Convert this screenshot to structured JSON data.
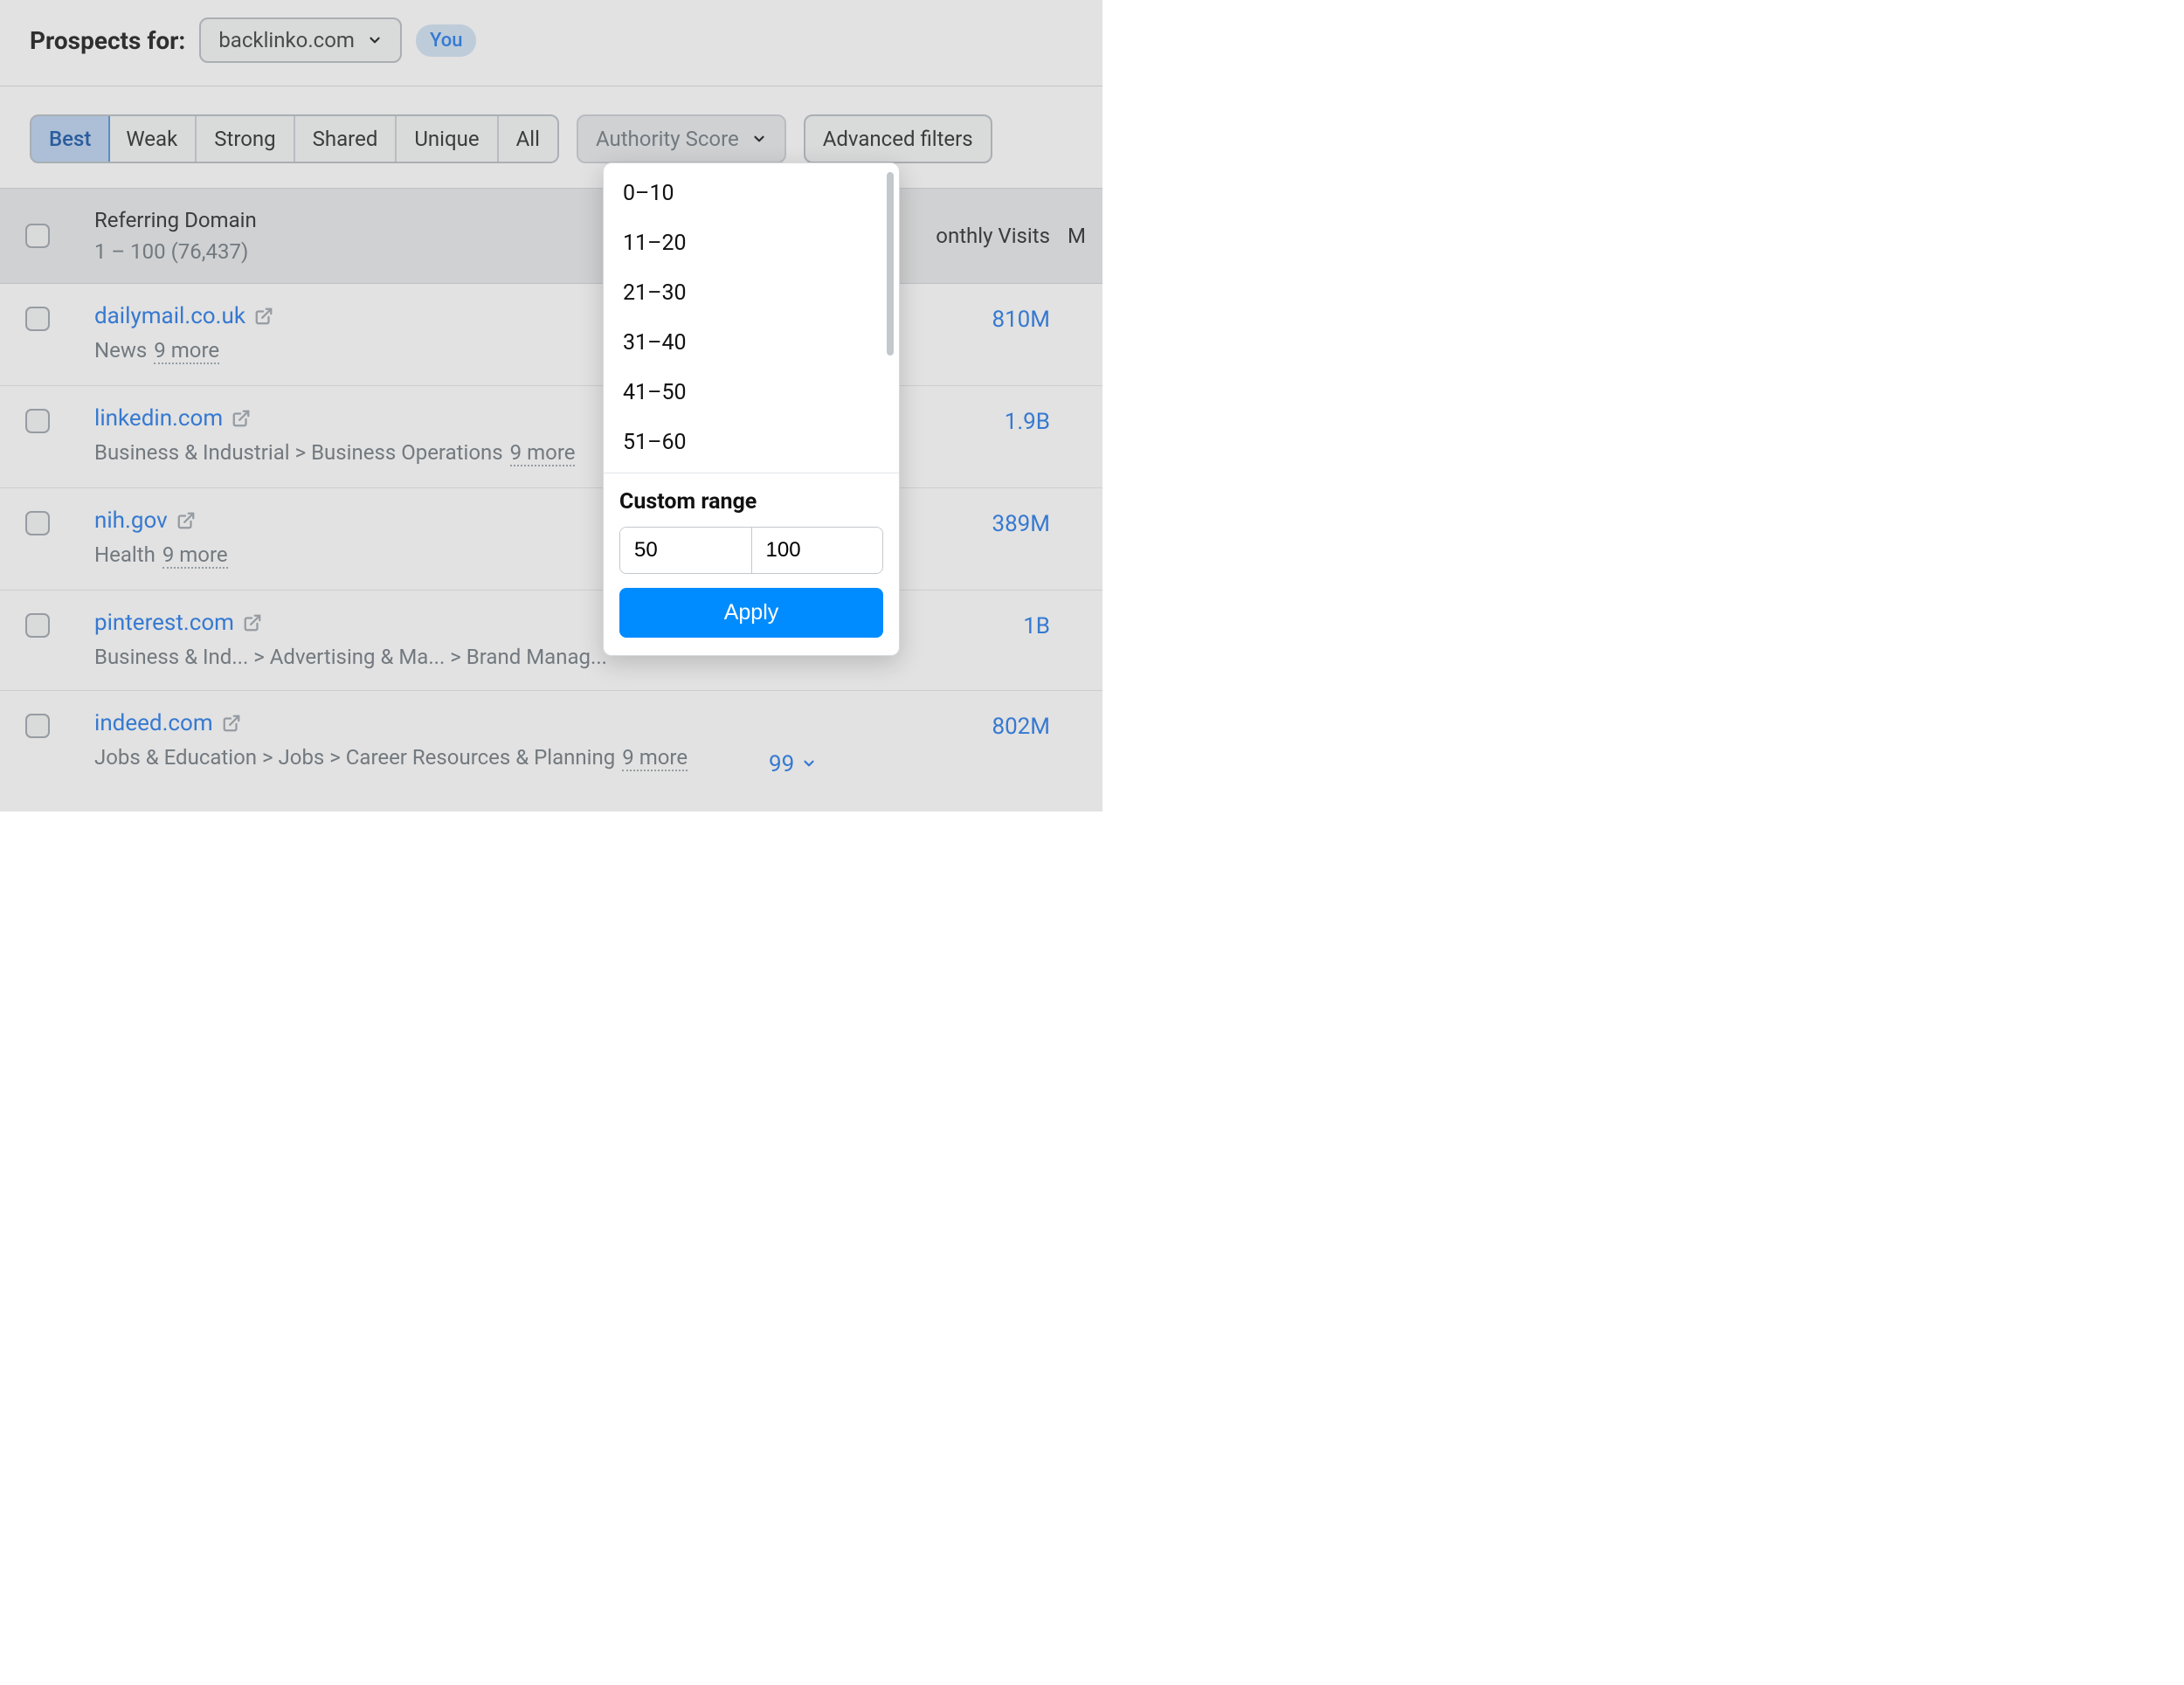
{
  "header": {
    "title": "Prospects for:",
    "domain": "backlinko.com",
    "badge": "You"
  },
  "tabs": [
    "Best",
    "Weak",
    "Strong",
    "Shared",
    "Unique",
    "All"
  ],
  "filters": {
    "authority_label": "Authority Score",
    "advanced_label": "Advanced filters"
  },
  "table": {
    "header": {
      "col_domain": "Referring Domain",
      "range_summary": "1 – 100 (76,437)",
      "col_visits": "onthly Visits",
      "col_last": "M"
    },
    "rows": [
      {
        "domain": "dailymail.co.uk",
        "category": "News",
        "more": "9 more",
        "visits": "810M"
      },
      {
        "domain": "linkedin.com",
        "category": "Business & Industrial > Business Operations",
        "more": "9 more",
        "visits": "1.9B"
      },
      {
        "domain": "nih.gov",
        "category": "Health",
        "more": "9 more",
        "visits": "389M"
      },
      {
        "domain": "pinterest.com",
        "category": "Business & Ind... > Advertising & Ma... > Brand Manag...",
        "more": "",
        "visits": "1B"
      },
      {
        "domain": "indeed.com",
        "category": "Jobs & Education > Jobs > Career Resources & Planning",
        "more": "9 more",
        "visits": "802M",
        "authority": "99"
      }
    ]
  },
  "dropdown": {
    "options": [
      "0–10",
      "11–20",
      "21–30",
      "31–40",
      "41–50",
      "51–60"
    ],
    "custom_title": "Custom range",
    "from": "50",
    "to": "100",
    "apply": "Apply"
  }
}
